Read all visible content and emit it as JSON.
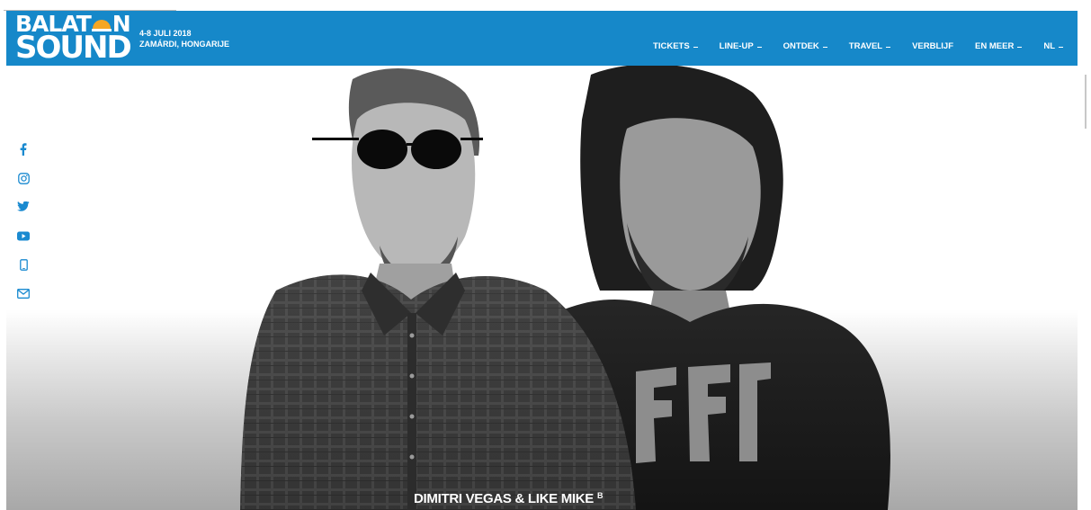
{
  "header": {
    "logo": {
      "line1_left": "BALAT",
      "line1_right": "N",
      "line2": "SOUND"
    },
    "dates": "4-8 JULI 2018",
    "location": "ZAMÁRDI, HONGARIJE"
  },
  "nav": {
    "items": [
      {
        "label": "TICKETS",
        "has_dropdown": true
      },
      {
        "label": "LINE-UP",
        "has_dropdown": true
      },
      {
        "label": "ONTDEK",
        "has_dropdown": true
      },
      {
        "label": "TRAVEL",
        "has_dropdown": true
      },
      {
        "label": "VERBLIJF",
        "has_dropdown": false
      },
      {
        "label": "EN MEER",
        "has_dropdown": true
      },
      {
        "label": "NL",
        "has_dropdown": true
      }
    ]
  },
  "social": [
    {
      "icon": "facebook-icon"
    },
    {
      "icon": "instagram-icon"
    },
    {
      "icon": "twitter-icon"
    },
    {
      "icon": "youtube-icon"
    },
    {
      "icon": "mobile-icon"
    },
    {
      "icon": "mail-icon"
    }
  ],
  "hero": {
    "artist_name": "DIMITRI VEGAS & LIKE MIKE",
    "stage_code": "B"
  },
  "colors": {
    "brand_blue": "#1688c9",
    "social_icon": "#1a8ad0",
    "logo_sun": "#f5a623",
    "text_white": "#ffffff"
  }
}
